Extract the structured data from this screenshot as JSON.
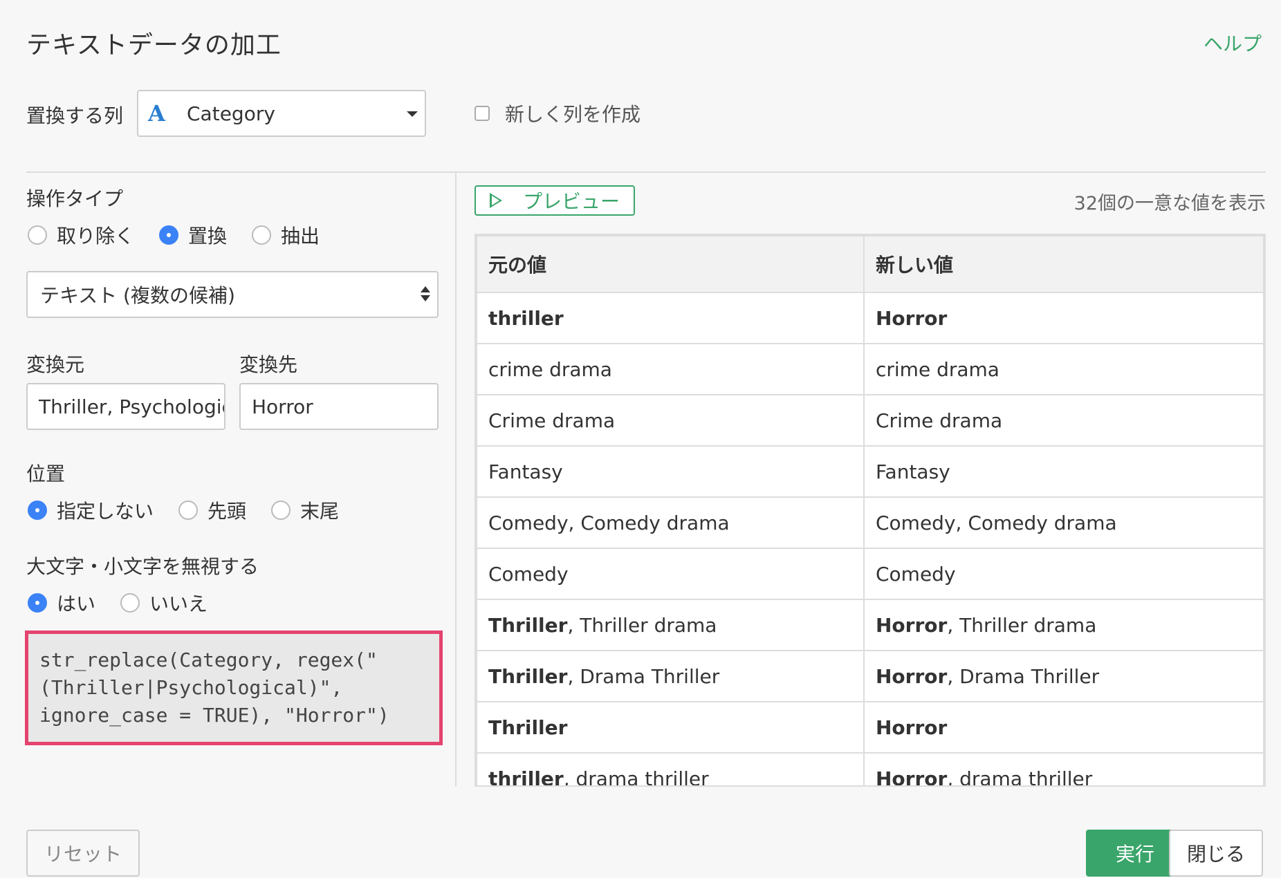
{
  "dialog": {
    "title": "テキストデータの加工",
    "help_link": "ヘルプ"
  },
  "column_row": {
    "label": "置換する列",
    "selected_column": "Category",
    "type_icon_text": "A",
    "new_column_checkbox_label": "新しく列を作成",
    "new_column_checked": false
  },
  "operation": {
    "label": "操作タイプ",
    "options": [
      "取り除く",
      "置換",
      "抽出"
    ],
    "selected": "置換",
    "mode_select_value": "テキスト (複数の候補)"
  },
  "replace": {
    "from_label": "変換元",
    "to_label": "変換先",
    "from_value": "Thriller, Psychologic",
    "to_value": "Horror"
  },
  "position": {
    "label": "位置",
    "options": [
      "指定しない",
      "先頭",
      "末尾"
    ],
    "selected": "指定しない"
  },
  "ignore_case": {
    "label": "大文字・小文字を無視する",
    "options": [
      "はい",
      "いいえ"
    ],
    "selected": "はい"
  },
  "code": {
    "line1": "str_replace(Category, regex(\"",
    "line2": "(Thriller|Psychological)\",",
    "line3": "ignore_case = TRUE), \"Horror\")"
  },
  "preview": {
    "button_label": "プレビュー",
    "unique_count_text": "32個の一意な値を表示",
    "headers": [
      "元の値",
      "新しい値"
    ],
    "rows": [
      {
        "orig_bold": "thriller",
        "orig_rest": "",
        "new_bold": "Horror",
        "new_rest": ""
      },
      {
        "orig_bold": "",
        "orig_rest": "crime drama",
        "new_bold": "",
        "new_rest": "crime drama"
      },
      {
        "orig_bold": "",
        "orig_rest": "Crime drama",
        "new_bold": "",
        "new_rest": "Crime drama"
      },
      {
        "orig_bold": "",
        "orig_rest": "Fantasy",
        "new_bold": "",
        "new_rest": "Fantasy"
      },
      {
        "orig_bold": "",
        "orig_rest": "Comedy, Comedy drama",
        "new_bold": "",
        "new_rest": "Comedy, Comedy drama"
      },
      {
        "orig_bold": "",
        "orig_rest": "Comedy",
        "new_bold": "",
        "new_rest": "Comedy"
      },
      {
        "orig_bold": "Thriller",
        "orig_rest": ", Thriller drama",
        "new_bold": "Horror",
        "new_rest": ", Thriller drama"
      },
      {
        "orig_bold": "Thriller",
        "orig_rest": ", Drama Thriller",
        "new_bold": "Horror",
        "new_rest": ", Drama Thriller"
      },
      {
        "orig_bold": "Thriller",
        "orig_rest": "",
        "new_bold": "Horror",
        "new_rest": ""
      },
      {
        "orig_bold": "thriller",
        "orig_rest": ", drama thriller",
        "new_bold": "Horror",
        "new_rest": ", drama thriller"
      }
    ]
  },
  "footer": {
    "reset_label": "リセット",
    "run_label": "実行",
    "close_label": "閉じる"
  },
  "colors": {
    "accent_green": "#3aa56a",
    "radio_blue": "#3b82f6",
    "code_highlight_border": "#e5436f"
  }
}
